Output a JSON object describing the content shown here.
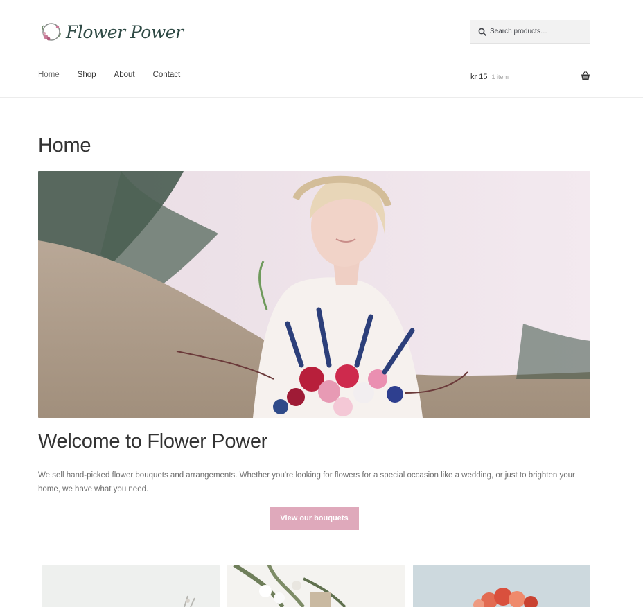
{
  "header": {
    "logo_text": "Flower Power",
    "search_placeholder": "Search products…",
    "nav": [
      {
        "label": "Home"
      },
      {
        "label": "Shop"
      },
      {
        "label": "About"
      },
      {
        "label": "Contact"
      }
    ],
    "cart": {
      "amount": "kr 15",
      "count": "1 item"
    }
  },
  "main": {
    "page_title": "Home",
    "welcome_heading": "Welcome to Flower Power",
    "intro": "We sell hand-picked flower bouquets and arrangements. Whether you're looking for flowers for a special occasion like a wedding, or just to brighten your home, we have what you need.",
    "cta_label": "View our bouquets"
  },
  "colors": {
    "accent": "#dfa9bb",
    "heading": "#333333",
    "body_text": "#6d6d6d",
    "logo": "#2f4a45"
  }
}
